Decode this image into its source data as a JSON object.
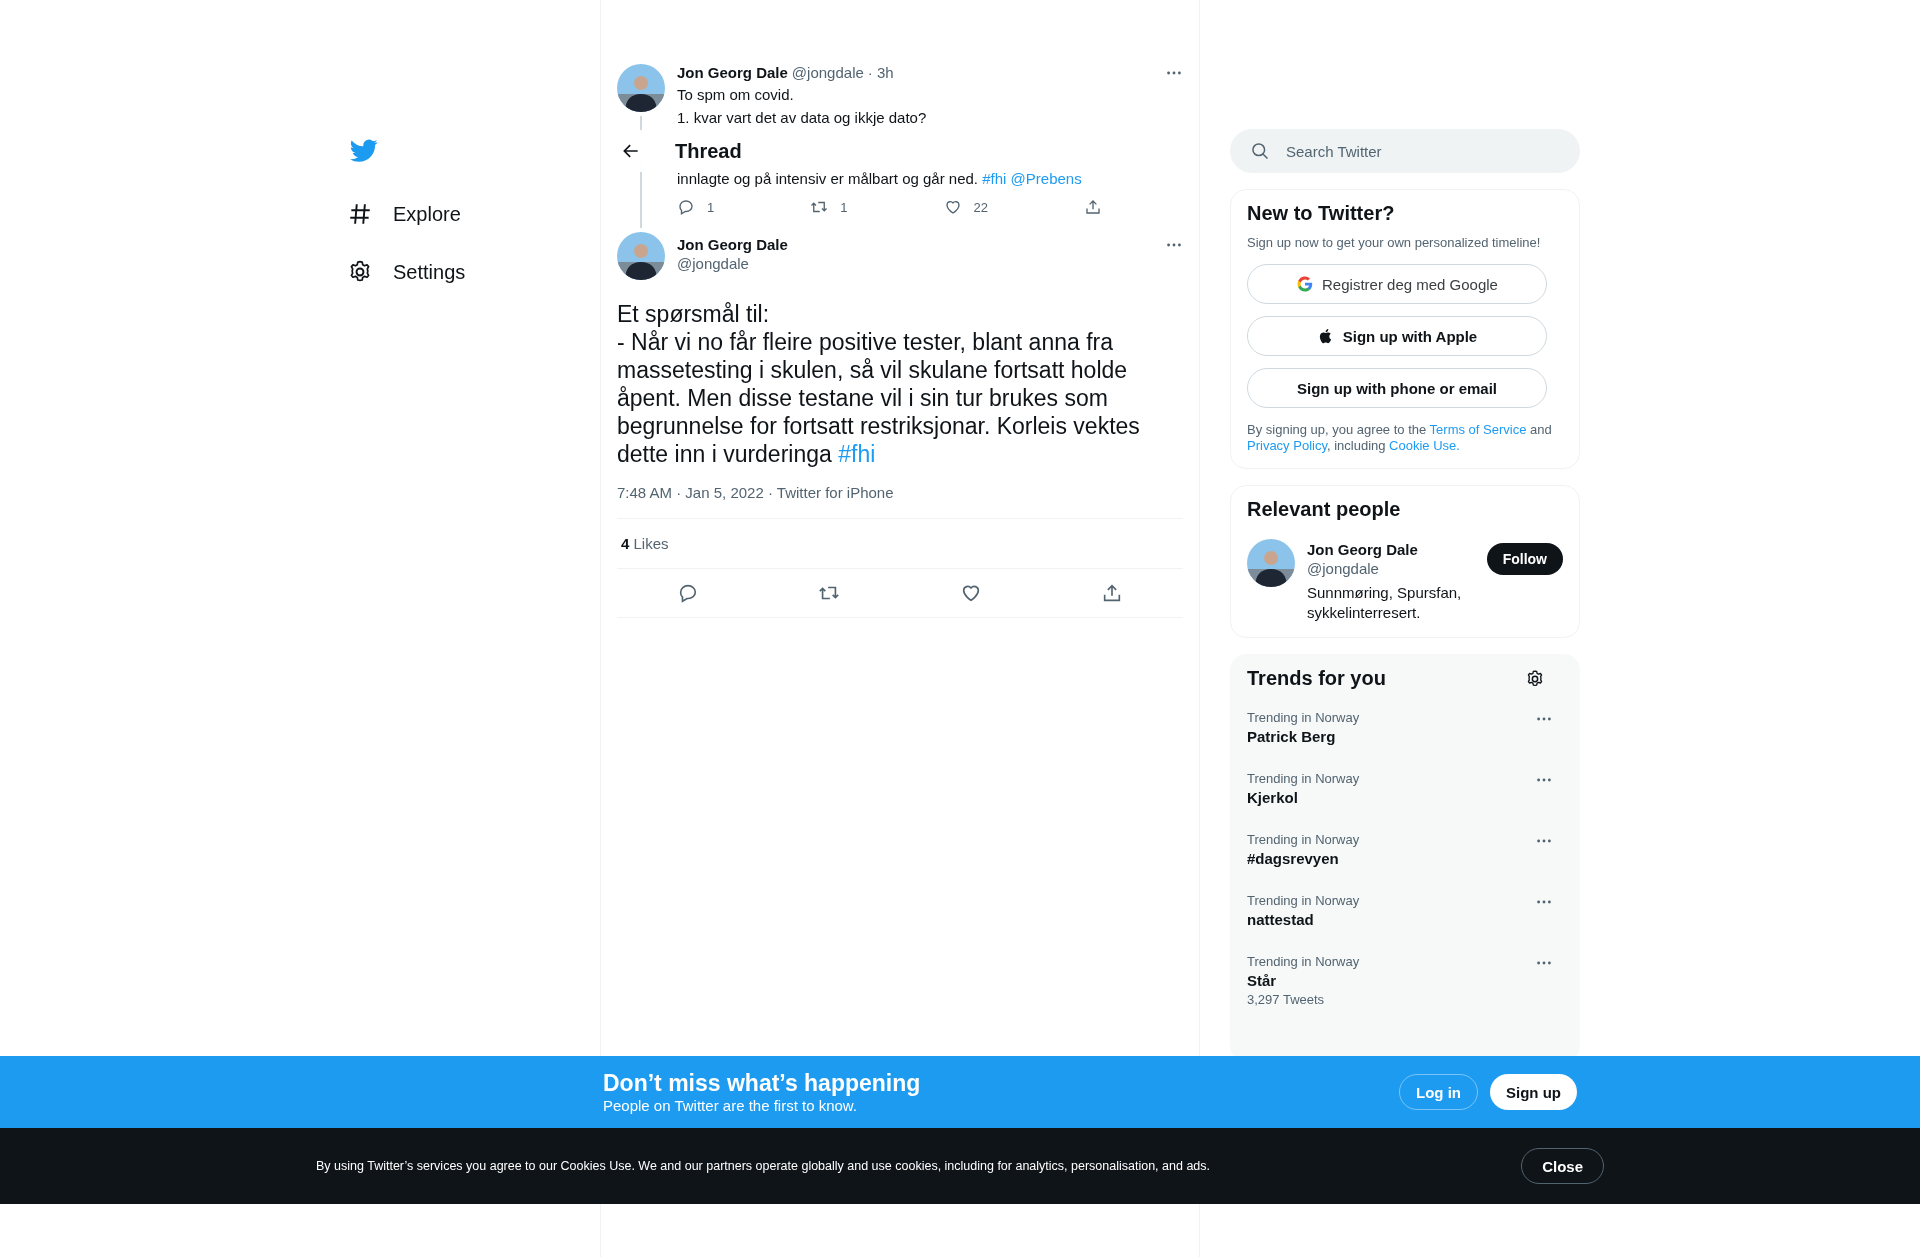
{
  "sidebar": {
    "items": [
      {
        "kind": "hash",
        "label": "Explore"
      },
      {
        "kind": "gear",
        "label": "Settings"
      }
    ]
  },
  "header": {
    "title": "Thread"
  },
  "parent_tweet": {
    "name": "Jon Georg Dale",
    "handle": "@jongdale",
    "time": "· 3h",
    "lines": [
      {
        "text": "To spm om covid."
      },
      {
        "text": "1. kvar vart det av data og ikkje dato?"
      },
      {
        "text": "innlagte og på intensiv er målbart og går ned.",
        "links": [
          "#fhi",
          "@Prebens"
        ]
      }
    ],
    "actions": [
      {
        "kind": "reply",
        "count": "1"
      },
      {
        "kind": "retweet",
        "count": "1"
      },
      {
        "kind": "like",
        "count": "22"
      },
      {
        "kind": "share"
      }
    ]
  },
  "tweet": {
    "name": "Jon Georg Dale",
    "handle": "@jongdale",
    "text": "Et spørsmål til:\n- Når vi no får fleire positive tester, blant anna fra massetesting i skulen, så vil skulane fortsatt holde åpent. Men disse testane vil i sin tur brukes som begrunnelse for fortsatt restriksjonar. Korleis vektes dette inn i vurderinga",
    "hashtag": "#fhi",
    "meta": "7:48 AM · Jan 5, 2022 · Twitter for iPhone",
    "likes": {
      "count": "4",
      "label": "Likes"
    },
    "actions": [
      {
        "kind": "reply"
      },
      {
        "kind": "retweet"
      },
      {
        "kind": "like"
      },
      {
        "kind": "share"
      }
    ]
  },
  "search": {
    "placeholder": "Search Twitter"
  },
  "signup": {
    "title": "New to Twitter?",
    "subtitle": "Sign up now to get your own personalized timeline!",
    "buttons": [
      {
        "kind": "google",
        "label": "Registrer deg med Google"
      },
      {
        "kind": "apple",
        "label": "Sign up with Apple"
      },
      {
        "kind": "plain",
        "label": "Sign up with phone or email"
      }
    ],
    "legal": [
      {
        "text": "By signing up, you agree to the ",
        "link": false
      },
      {
        "text": "Terms of Service",
        "link": true
      },
      {
        "text": " and ",
        "link": false
      },
      {
        "text": "Privacy Policy",
        "link": true
      },
      {
        "text": ", including ",
        "link": false
      },
      {
        "text": "Cookie Use.",
        "link": true
      }
    ]
  },
  "relevant_people": {
    "title": "Relevant people",
    "people": [
      {
        "name": "Jon Georg Dale",
        "handle": "@jongdale",
        "bio": "Sunnmøring, Spursfan, sykkelinterresert.",
        "button": "Follow"
      }
    ]
  },
  "trends": {
    "title": "Trends for you",
    "items": [
      {
        "context": "Trending in Norway",
        "name": "Patrick Berg"
      },
      {
        "context": "Trending in Norway",
        "name": "Kjerkol"
      },
      {
        "context": "Trending in Norway",
        "name": "#dagsrevyen"
      },
      {
        "context": "Trending in Norway",
        "name": "nattestad"
      },
      {
        "context": "Trending in Norway",
        "name": "Står",
        "count": "3,297 Tweets"
      }
    ]
  },
  "banner": {
    "title": "Don’t miss what’s happening",
    "subtitle": "People on Twitter are the first to know.",
    "buttons": [
      {
        "kind": "outline",
        "label": "Log in"
      },
      {
        "kind": "filled",
        "label": "Sign up"
      }
    ]
  },
  "cookie": {
    "text": "By using Twitter’s services you agree to our Cookies Use. We and our partners operate globally and use cookies, including for analytics, personalisation, and ads.",
    "button": "Close"
  }
}
